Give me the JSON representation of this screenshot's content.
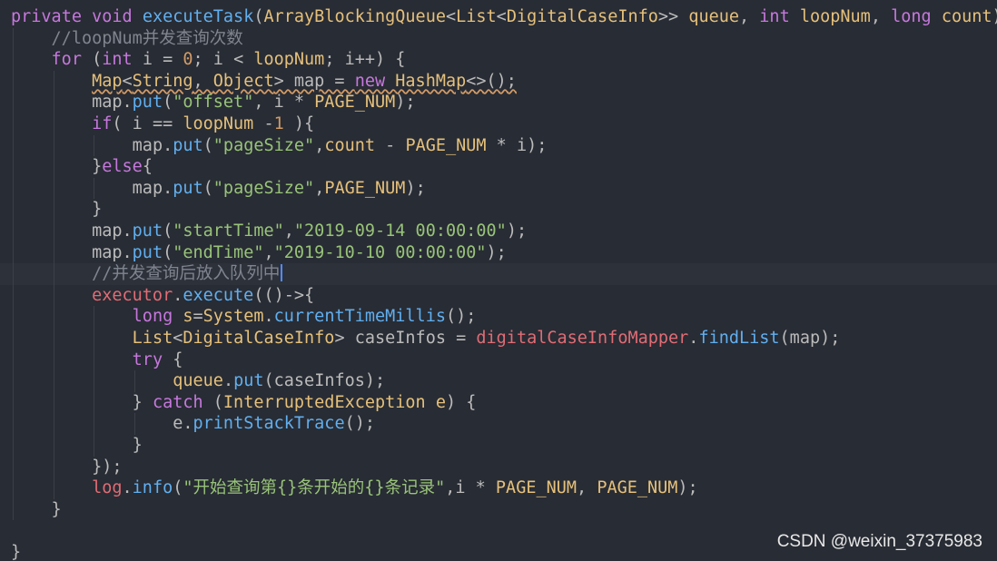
{
  "editor": {
    "theme": "one-dark",
    "colors": {
      "background": "#282c34",
      "keyword": "#c678dd",
      "method": "#61afef",
      "type": "#e5c07b",
      "string": "#98c379",
      "number": "#d19a66",
      "comment": "#7f848e",
      "field": "#e06c75",
      "plain": "#bbbbbb"
    },
    "lines": [
      {
        "indent": 0,
        "tokens": [
          {
            "t": "private ",
            "c": "keyword"
          },
          {
            "t": "void ",
            "c": "keyword"
          },
          {
            "t": "executeTask",
            "c": "method"
          },
          {
            "t": "(",
            "c": "plain"
          },
          {
            "t": "ArrayBlockingQueue",
            "c": "type"
          },
          {
            "t": "<",
            "c": "plain"
          },
          {
            "t": "List",
            "c": "type"
          },
          {
            "t": "<",
            "c": "plain"
          },
          {
            "t": "DigitalCaseInfo",
            "c": "type"
          },
          {
            "t": ">> ",
            "c": "plain"
          },
          {
            "t": "queue",
            "c": "param"
          },
          {
            "t": ", ",
            "c": "plain"
          },
          {
            "t": "int ",
            "c": "keyword"
          },
          {
            "t": "loopNum",
            "c": "param"
          },
          {
            "t": ", ",
            "c": "plain"
          },
          {
            "t": "long ",
            "c": "keyword"
          },
          {
            "t": "count",
            "c": "param"
          },
          {
            "t": ")",
            "c": "plain"
          }
        ]
      },
      {
        "indent": 1,
        "tokens": [
          {
            "t": "//loopNum并发查询次数",
            "c": "comment"
          }
        ]
      },
      {
        "indent": 1,
        "tokens": [
          {
            "t": "for ",
            "c": "keyword"
          },
          {
            "t": "(",
            "c": "plain"
          },
          {
            "t": "int ",
            "c": "keyword"
          },
          {
            "t": "i = ",
            "c": "plain"
          },
          {
            "t": "0",
            "c": "number"
          },
          {
            "t": "; i < ",
            "c": "plain"
          },
          {
            "t": "loopNum",
            "c": "param"
          },
          {
            "t": "; i++) {",
            "c": "plain"
          }
        ]
      },
      {
        "indent": 2,
        "tokens": [
          {
            "t": "Map",
            "c": "type",
            "squiggly": true
          },
          {
            "t": "<",
            "c": "plain",
            "squiggly": true
          },
          {
            "t": "String",
            "c": "type",
            "squiggly": true
          },
          {
            "t": ", ",
            "c": "plain",
            "squiggly": true
          },
          {
            "t": "Object",
            "c": "type",
            "squiggly": true
          },
          {
            "t": "> map = ",
            "c": "plain",
            "squiggly": true
          },
          {
            "t": "new ",
            "c": "keyword",
            "squiggly": true
          },
          {
            "t": "HashMap",
            "c": "type",
            "squiggly": true
          },
          {
            "t": "<>();",
            "c": "plain",
            "squiggly": true
          }
        ]
      },
      {
        "indent": 2,
        "tokens": [
          {
            "t": "map.",
            "c": "plain"
          },
          {
            "t": "put",
            "c": "method"
          },
          {
            "t": "(",
            "c": "plain"
          },
          {
            "t": "\"offset\"",
            "c": "string"
          },
          {
            "t": ", i * ",
            "c": "plain"
          },
          {
            "t": "PAGE_NUM",
            "c": "const"
          },
          {
            "t": ");",
            "c": "plain"
          }
        ]
      },
      {
        "indent": 2,
        "tokens": [
          {
            "t": "if",
            "c": "keyword"
          },
          {
            "t": "( i == ",
            "c": "plain"
          },
          {
            "t": "loopNum ",
            "c": "param"
          },
          {
            "t": "-",
            "c": "plain"
          },
          {
            "t": "1",
            "c": "number"
          },
          {
            "t": " ){",
            "c": "plain"
          }
        ]
      },
      {
        "indent": 3,
        "tokens": [
          {
            "t": "map.",
            "c": "plain"
          },
          {
            "t": "put",
            "c": "method"
          },
          {
            "t": "(",
            "c": "plain"
          },
          {
            "t": "\"pageSize\"",
            "c": "string"
          },
          {
            "t": ",",
            "c": "plain"
          },
          {
            "t": "count ",
            "c": "param"
          },
          {
            "t": "- ",
            "c": "plain"
          },
          {
            "t": "PAGE_NUM",
            "c": "const"
          },
          {
            "t": " * i);",
            "c": "plain"
          }
        ]
      },
      {
        "indent": 2,
        "tokens": [
          {
            "t": "}",
            "c": "plain"
          },
          {
            "t": "else",
            "c": "keyword"
          },
          {
            "t": "{",
            "c": "plain"
          }
        ]
      },
      {
        "indent": 3,
        "tokens": [
          {
            "t": "map.",
            "c": "plain"
          },
          {
            "t": "put",
            "c": "method"
          },
          {
            "t": "(",
            "c": "plain"
          },
          {
            "t": "\"pageSize\"",
            "c": "string"
          },
          {
            "t": ",",
            "c": "plain"
          },
          {
            "t": "PAGE_NUM",
            "c": "const"
          },
          {
            "t": ");",
            "c": "plain"
          }
        ]
      },
      {
        "indent": 2,
        "tokens": [
          {
            "t": "}",
            "c": "plain"
          }
        ]
      },
      {
        "indent": 2,
        "tokens": [
          {
            "t": "map.",
            "c": "plain"
          },
          {
            "t": "put",
            "c": "method"
          },
          {
            "t": "(",
            "c": "plain"
          },
          {
            "t": "\"startTime\"",
            "c": "string"
          },
          {
            "t": ",",
            "c": "plain"
          },
          {
            "t": "\"2019-09-14 00:00:00\"",
            "c": "string"
          },
          {
            "t": ");",
            "c": "plain"
          }
        ]
      },
      {
        "indent": 2,
        "tokens": [
          {
            "t": "map.",
            "c": "plain"
          },
          {
            "t": "put",
            "c": "method"
          },
          {
            "t": "(",
            "c": "plain"
          },
          {
            "t": "\"endTime\"",
            "c": "string"
          },
          {
            "t": ",",
            "c": "plain"
          },
          {
            "t": "\"2019-10-10 00:00:00\"",
            "c": "string"
          },
          {
            "t": ");",
            "c": "plain"
          }
        ]
      },
      {
        "indent": 2,
        "current": true,
        "caret": true,
        "tokens": [
          {
            "t": "//并发查询后放入队列中",
            "c": "comment"
          }
        ]
      },
      {
        "indent": 2,
        "tokens": [
          {
            "t": "executor",
            "c": "field"
          },
          {
            "t": ".",
            "c": "plain"
          },
          {
            "t": "execute",
            "c": "method"
          },
          {
            "t": "(()->{",
            "c": "plain"
          }
        ]
      },
      {
        "indent": 3,
        "tokens": [
          {
            "t": "long ",
            "c": "keyword"
          },
          {
            "t": "s",
            "c": "var"
          },
          {
            "t": "=",
            "c": "plain"
          },
          {
            "t": "System",
            "c": "type"
          },
          {
            "t": ".",
            "c": "plain"
          },
          {
            "t": "currentTimeMillis",
            "c": "method"
          },
          {
            "t": "();",
            "c": "plain"
          }
        ]
      },
      {
        "indent": 3,
        "tokens": [
          {
            "t": "List",
            "c": "type"
          },
          {
            "t": "<",
            "c": "plain"
          },
          {
            "t": "DigitalCaseInfo",
            "c": "type"
          },
          {
            "t": "> caseInfos = ",
            "c": "plain"
          },
          {
            "t": "digitalCaseInfoMapper",
            "c": "field"
          },
          {
            "t": ".",
            "c": "plain"
          },
          {
            "t": "findList",
            "c": "method"
          },
          {
            "t": "(map);",
            "c": "plain"
          }
        ]
      },
      {
        "indent": 3,
        "tokens": [
          {
            "t": "try ",
            "c": "keyword"
          },
          {
            "t": "{",
            "c": "plain"
          }
        ]
      },
      {
        "indent": 4,
        "tokens": [
          {
            "t": "queue",
            "c": "param"
          },
          {
            "t": ".",
            "c": "plain"
          },
          {
            "t": "put",
            "c": "method"
          },
          {
            "t": "(caseInfos);",
            "c": "plain"
          }
        ]
      },
      {
        "indent": 3,
        "tokens": [
          {
            "t": "} ",
            "c": "plain"
          },
          {
            "t": "catch ",
            "c": "keyword"
          },
          {
            "t": "(",
            "c": "plain"
          },
          {
            "t": "InterruptedException ",
            "c": "type"
          },
          {
            "t": "e",
            "c": "param"
          },
          {
            "t": ") {",
            "c": "plain"
          }
        ]
      },
      {
        "indent": 4,
        "tokens": [
          {
            "t": "e.",
            "c": "plain"
          },
          {
            "t": "printStackTrace",
            "c": "method"
          },
          {
            "t": "();",
            "c": "plain"
          }
        ]
      },
      {
        "indent": 3,
        "tokens": [
          {
            "t": "}",
            "c": "plain"
          }
        ]
      },
      {
        "indent": 2,
        "tokens": [
          {
            "t": "});",
            "c": "plain"
          }
        ]
      },
      {
        "indent": 2,
        "tokens": [
          {
            "t": "log",
            "c": "field"
          },
          {
            "t": ".",
            "c": "plain"
          },
          {
            "t": "info",
            "c": "method"
          },
          {
            "t": "(",
            "c": "plain"
          },
          {
            "t": "\"开始查询第{}条开始的{}条记录\"",
            "c": "string"
          },
          {
            "t": ",i * ",
            "c": "plain"
          },
          {
            "t": "PAGE_NUM",
            "c": "const"
          },
          {
            "t": ", ",
            "c": "plain"
          },
          {
            "t": "PAGE_NUM",
            "c": "const"
          },
          {
            "t": ");",
            "c": "plain"
          }
        ]
      },
      {
        "indent": 1,
        "tokens": [
          {
            "t": "}",
            "c": "plain"
          }
        ]
      },
      {
        "indent": 0,
        "tokens": []
      },
      {
        "indent": 0,
        "tokens": [
          {
            "t": "}",
            "c": "plain"
          }
        ]
      }
    ]
  },
  "watermark": "CSDN @weixin_37375983"
}
